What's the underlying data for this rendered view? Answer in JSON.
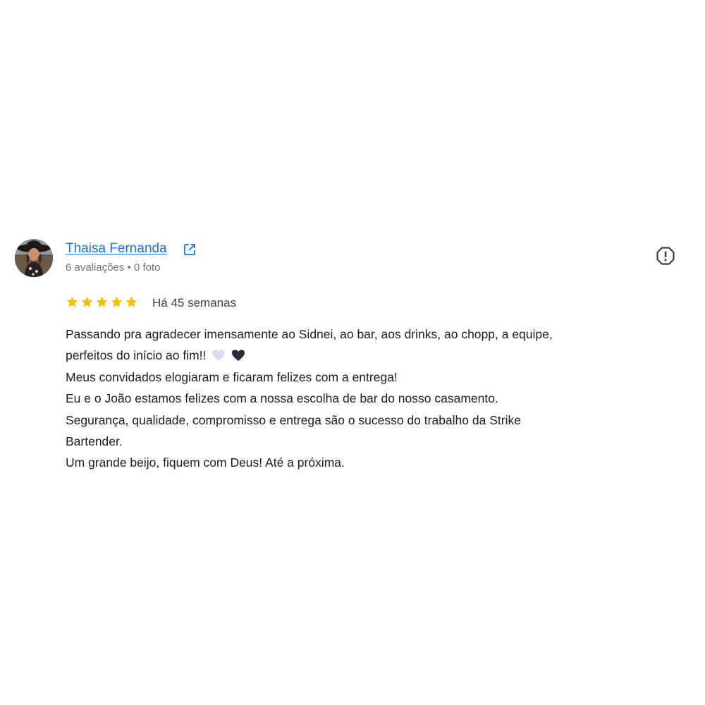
{
  "reviewer": {
    "name": "Thaisa Fernanda",
    "meta": "6 avaliações • 0 foto",
    "avatar_icon": "profile-photo",
    "link_icon": "open-in-new-icon"
  },
  "rating": {
    "stars": 5,
    "max": 5,
    "star_color": "#fbbc04",
    "date": "Há 45 semanas"
  },
  "review": {
    "lines": [
      "Passando pra agradecer imensamente ao Sidnei, ao bar, aos drinks, ao chopp, a equipe,",
      "perfeitos do início ao fim!!",
      "Meus convidados elogiaram e ficaram felizes com a entrega!",
      "Eu e o João estamos felizes com a nossa escolha de bar do nosso casamento.",
      "Segurança, qualidade, compromisso e entrega são o sucesso do trabalho da Strike",
      "Bartender.",
      "Um grande beijo, fiquem com Deus! Até a próxima."
    ],
    "emojis": [
      "light-purple-heart-icon",
      "black-heart-icon"
    ]
  },
  "actions": {
    "report_icon": "report-icon"
  },
  "colors": {
    "link": "#1a73e8",
    "meta": "#70757a",
    "text": "#202124"
  }
}
